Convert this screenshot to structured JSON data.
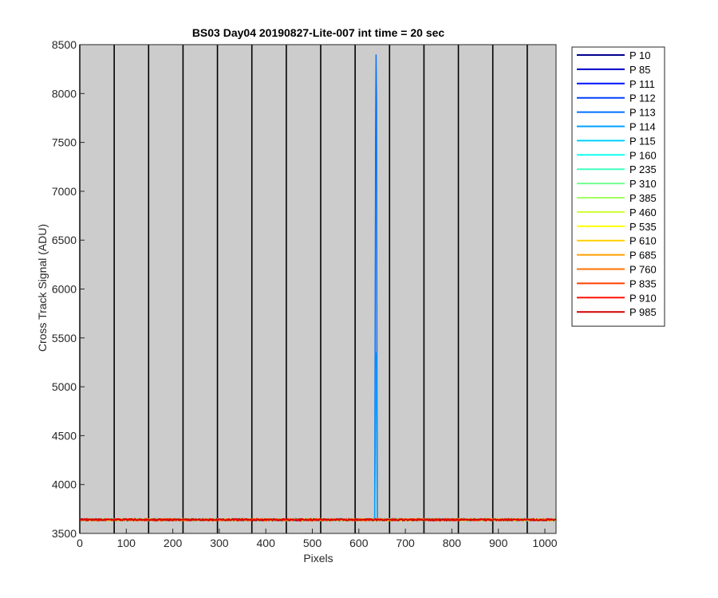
{
  "chart_data": {
    "type": "line",
    "title": "BS03 Day04 20190827-Lite-007 int time = 20 sec",
    "xlabel": "Pixels",
    "ylabel": "Cross Track Signal (ADU)",
    "xlim": [
      0,
      1024
    ],
    "ylim": [
      3500,
      8500
    ],
    "xticks": [
      0,
      100,
      200,
      300,
      400,
      500,
      600,
      700,
      800,
      900,
      1000
    ],
    "yticks": [
      3500,
      4000,
      4500,
      5000,
      5500,
      6000,
      6500,
      7000,
      7500,
      8000,
      8500
    ],
    "background_color": "#cccccc",
    "legend_position": "outside-top-right",
    "baseline_level": 3640,
    "baseline_noise": 10,
    "vertical_dividers_x": [
      0,
      74,
      148,
      222,
      296,
      370,
      444,
      518,
      592,
      666,
      740,
      814,
      888,
      962
    ],
    "series": [
      {
        "name": "P 10",
        "color": "#00008f"
      },
      {
        "name": "P 85",
        "color": "#0000c8"
      },
      {
        "name": "P 111",
        "color": "#0010ff"
      },
      {
        "name": "P 112",
        "color": "#0040ff"
      },
      {
        "name": "P 113",
        "color": "#0070ff",
        "spike": {
          "x": [
            634,
            635,
            636,
            637,
            638,
            639,
            640
          ],
          "y": [
            3640,
            5400,
            7600,
            8400,
            7900,
            5200,
            3640
          ]
        }
      },
      {
        "name": "P 114",
        "color": "#00a0ff",
        "spike": {
          "x": [
            634,
            635,
            636,
            637,
            638,
            639,
            640
          ],
          "y": [
            3640,
            4200,
            5000,
            5350,
            4900,
            4100,
            3640
          ]
        }
      },
      {
        "name": "P 115",
        "color": "#00d0ff"
      },
      {
        "name": "P 160",
        "color": "#10ffef"
      },
      {
        "name": "P 235",
        "color": "#40ffbf"
      },
      {
        "name": "P 310",
        "color": "#70ff8f"
      },
      {
        "name": "P 385",
        "color": "#9fff60"
      },
      {
        "name": "P 460",
        "color": "#cfff30"
      },
      {
        "name": "P 535",
        "color": "#ffff00"
      },
      {
        "name": "P 610",
        "color": "#ffcf00"
      },
      {
        "name": "P 685",
        "color": "#ff9f00"
      },
      {
        "name": "P 760",
        "color": "#ff7000"
      },
      {
        "name": "P 835",
        "color": "#ff4000"
      },
      {
        "name": "P 910",
        "color": "#ff1000"
      },
      {
        "name": "P 985",
        "color": "#d00000"
      }
    ]
  }
}
